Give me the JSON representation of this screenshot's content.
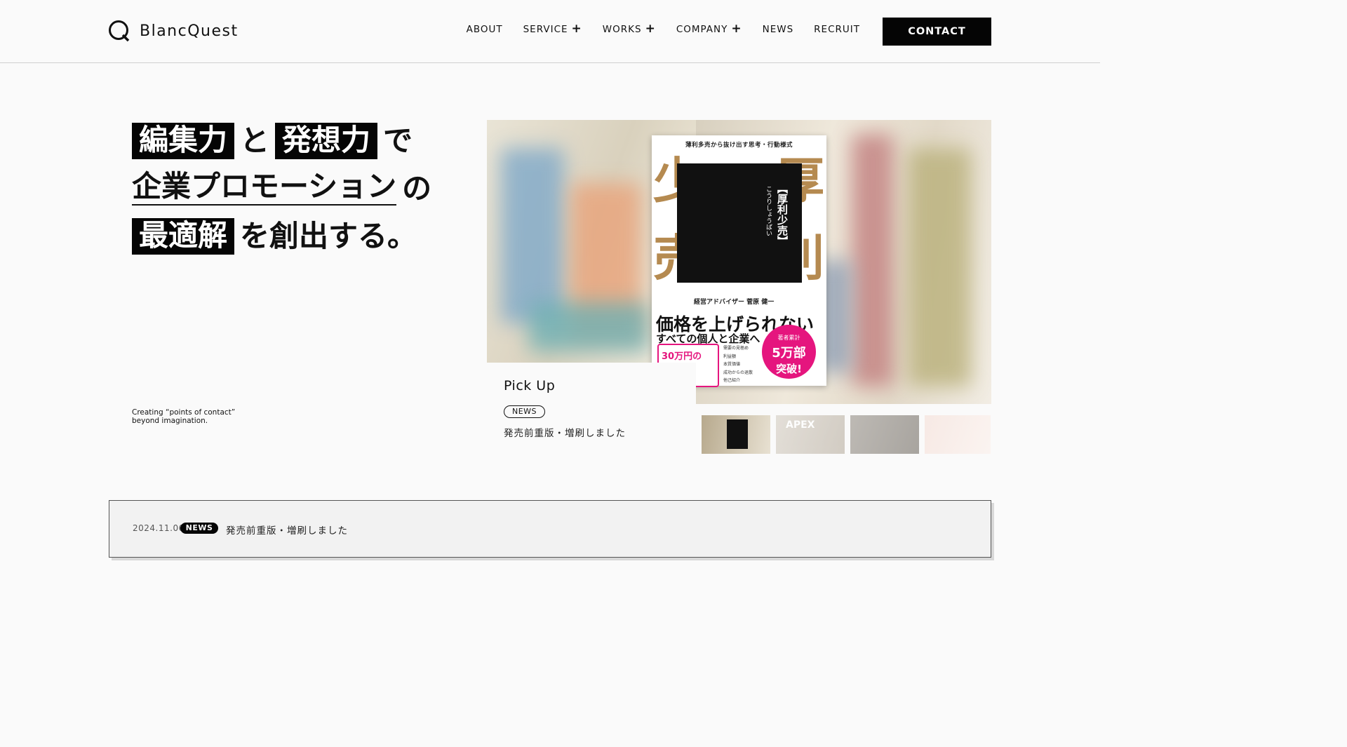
{
  "header": {
    "logo_text": "BlancQuest",
    "nav": [
      {
        "label": "ABOUT",
        "has_submenu": false
      },
      {
        "label": "SERVICE",
        "has_submenu": true
      },
      {
        "label": "WORKS",
        "has_submenu": true
      },
      {
        "label": "COMPANY",
        "has_submenu": true
      },
      {
        "label": "NEWS",
        "has_submenu": false
      },
      {
        "label": "RECRUIT",
        "has_submenu": false
      }
    ],
    "submenu_symbol": "+",
    "contact_label": "CONTACT"
  },
  "hero": {
    "line1": {
      "box1": "編集力",
      "mid": "と",
      "box2": "発想力",
      "end": "で"
    },
    "line2": {
      "underlined": "企業プロモーション",
      "end": "の"
    },
    "line3": {
      "box": "最適解",
      "end": "を創出する。"
    },
    "tagline_1": "Creating “points of contact”",
    "tagline_2": "beyond imagination."
  },
  "feature": {
    "cover": {
      "top_text": "薄利多売から抜け出す思考・行動様式",
      "brown_1": "少",
      "brown_2": "厚",
      "brown_3": "売",
      "brown_4": "利",
      "title_vertical": "【厚利少売】",
      "reading_vertical": "こうりしょうばい",
      "author": "経営アドバイザー 菅原 健一",
      "main_copy": "価格を上げられない",
      "sub_copy": "すべての個人と企業へ",
      "badge_small": "著者累計",
      "badge_large": "5万部",
      "badge_medium": "突破!",
      "frame_text": "30万円の",
      "list": [
        "需要の見極め",
        "利益額",
        "本質価値",
        "成功からの退散",
        "他己紹介"
      ]
    },
    "pickup_title": "Pick Up",
    "pickup_tag": "NEWS",
    "pickup_description": "発売前重版・増刷しました",
    "thumbnails": [
      {
        "label": "",
        "selected": true
      },
      {
        "label": "APEX",
        "selected": false
      },
      {
        "label": "",
        "selected": false
      },
      {
        "label": "",
        "selected": false
      }
    ]
  },
  "news": {
    "date": "2024.11.06",
    "tag": "NEWS",
    "text": "発売前重版・増刷しました"
  },
  "colors": {
    "background": "#fafafa",
    "black": "#050505",
    "accent_pink": "#e5157e",
    "cover_brown": "#b58a50"
  }
}
